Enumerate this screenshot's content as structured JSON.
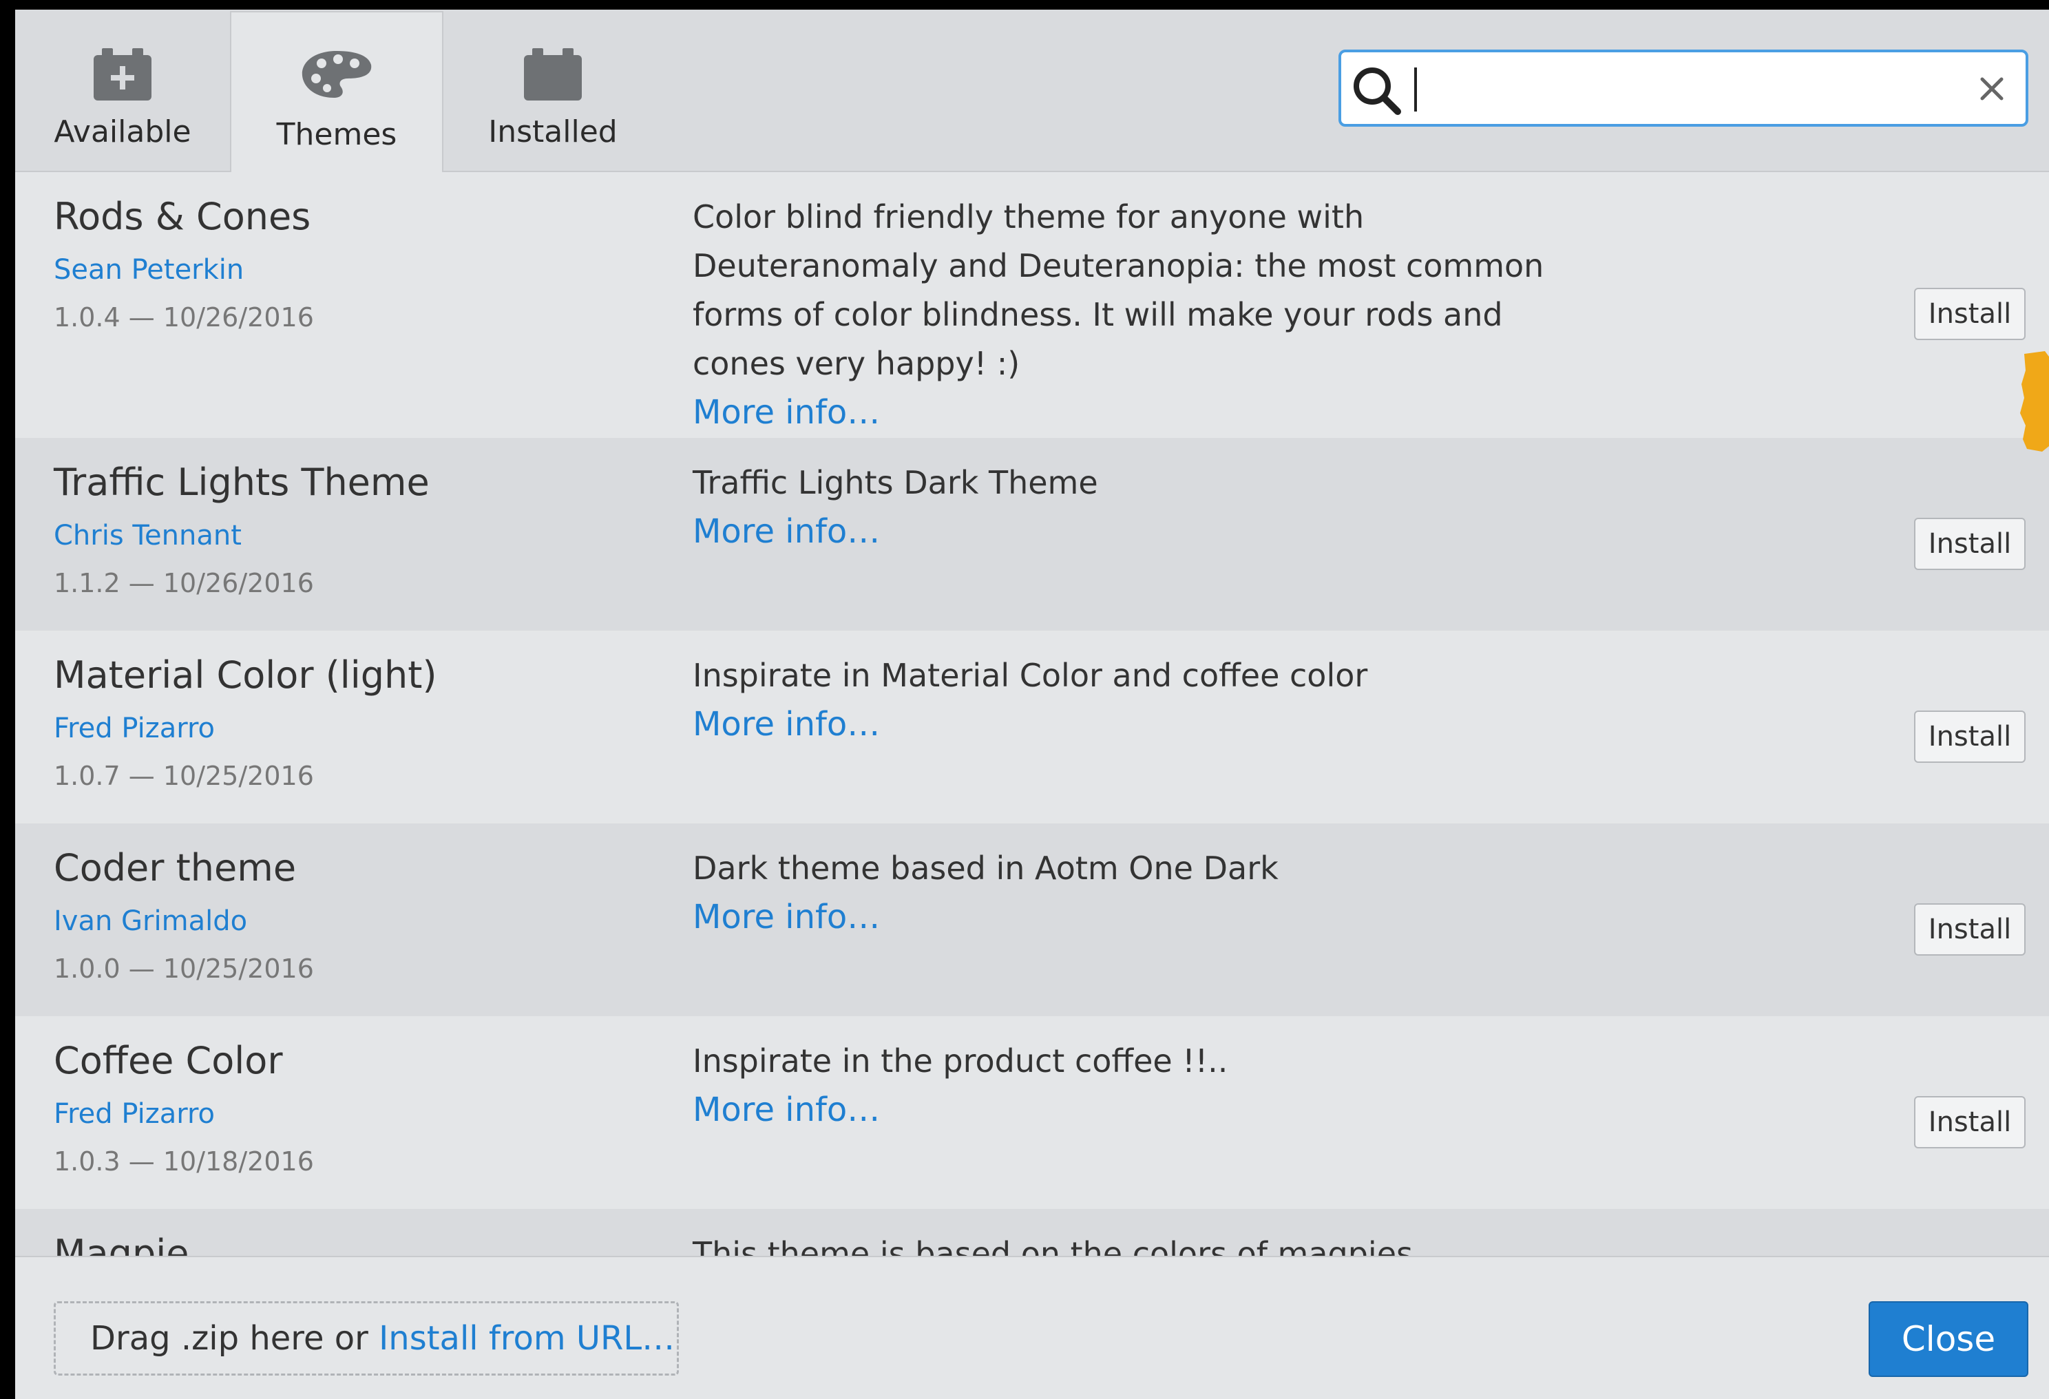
{
  "tabs": {
    "available": {
      "label": "Available",
      "icon": "plus-box-icon"
    },
    "themes": {
      "label": "Themes",
      "icon": "palette-icon",
      "selected": true
    },
    "installed": {
      "label": "Installed",
      "icon": "box-icon"
    }
  },
  "search": {
    "value": "",
    "placeholder": ""
  },
  "extensions": [
    {
      "title": "Rods & Cones",
      "author": "Sean Peterkin",
      "meta": "1.0.4 — 10/26/2016",
      "description": "Color blind friendly theme for anyone with Deuteranomaly and Deuteranopia: the most common forms of color blindness. It will make your rods and cones very happy! :)",
      "more_info": "More info…",
      "install_label": "Install"
    },
    {
      "title": "Traffic Lights Theme",
      "author": "Chris Tennant",
      "meta": "1.1.2 — 10/26/2016",
      "description": "Traffic Lights Dark Theme",
      "more_info": "More info…",
      "install_label": "Install"
    },
    {
      "title": "Material Color (light)",
      "author": "Fred Pizarro",
      "meta": "1.0.7 — 10/25/2016",
      "description": "Inspirate in Material Color and coffee color",
      "more_info": "More info…",
      "install_label": "Install"
    },
    {
      "title": "Coder theme",
      "author": "Ivan Grimaldo",
      "meta": "1.0.0 — 10/25/2016",
      "description": "Dark theme based in Aotm One Dark",
      "more_info": "More info…",
      "install_label": "Install"
    },
    {
      "title": "Coffee Color",
      "author": "Fred Pizarro",
      "meta": "1.0.3 — 10/18/2016",
      "description": "Inspirate in the product coffee !!..",
      "more_info": "More info…",
      "install_label": "Install"
    },
    {
      "title": "Magpie",
      "description": "This theme is based on the colors of magpies"
    }
  ],
  "footer": {
    "drop_text": "Drag .zip here or ",
    "install_url_link": "Install from URL…",
    "close_label": "Close"
  },
  "colors": {
    "accent": "#1f7fd1",
    "search_focus_border": "#4a9ee3",
    "scroll_marker": "#f0a818"
  }
}
